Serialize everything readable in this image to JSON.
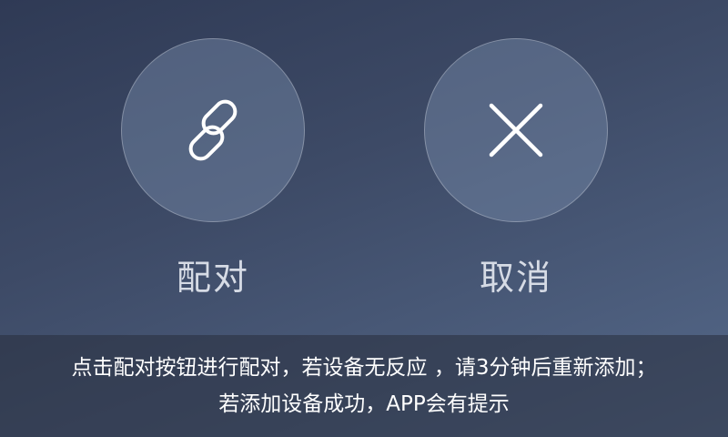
{
  "buttons": {
    "pair": {
      "label": "配对",
      "icon": "link-icon"
    },
    "cancel": {
      "label": "取消",
      "icon": "close-icon"
    }
  },
  "hint": {
    "line1": "点击配对按钮进行配对，若设备无反应 ，请3分钟后重新添加；",
    "line2": "若添加设备成功，APP会有提示"
  },
  "colors": {
    "bg_top": "#2f3a55",
    "bg_bottom": "#55698a",
    "circle_fill": "#5a6b88",
    "text": "#d6dbe5"
  }
}
